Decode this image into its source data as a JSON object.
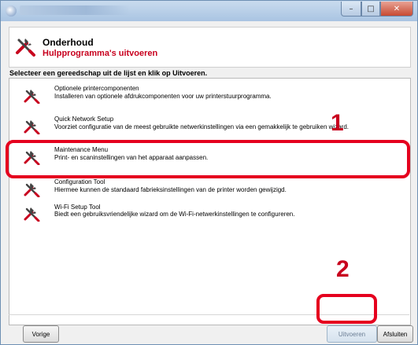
{
  "window": {
    "min_glyph": "–",
    "max_glyph": "□",
    "close_glyph": "✕"
  },
  "header": {
    "title": "Onderhoud",
    "subtitle": "Hulpprogramma's uitvoeren",
    "icon": "tools-icon"
  },
  "instruction": "Selecteer een gereedschap uit de lijst en klik op Uitvoeren.",
  "tools": [
    {
      "title": "Optionele printercomponenten",
      "description": "Installeren van optionele afdrukcomponenten voor uw printerstuurprogramma.",
      "icon": "tools-icon"
    },
    {
      "title": "Quick Network Setup",
      "description": "Voorziet configuratie van de meest gebruikte netwerkinstellingen via een gemakkelijk te gebruiken wizard.",
      "icon": "tools-icon"
    },
    {
      "title": "Maintenance Menu",
      "description": "Print- en scaninstellingen van het apparaat aanpassen.",
      "icon": "tools-icon"
    },
    {
      "title": "Configuration Tool",
      "description": "Hiermee kunnen de standaard fabrieksinstellingen van de printer worden gewijzigd.",
      "icon": "tools-icon"
    },
    {
      "title": "Wi-Fi Setup Tool",
      "description": "Biedt een gebruiksvriendelijke wizard om de Wi-Fi-netwerkinstellingen te configureren.",
      "icon": "tools-icon"
    }
  ],
  "callouts": {
    "step1": "1",
    "step2": "2"
  },
  "buttons": {
    "back": "Vorige",
    "run": "Uitvoeren",
    "close": "Afsluiten"
  },
  "colors": {
    "accent_red": "#c8001e",
    "highlight_red": "#e5001e"
  }
}
